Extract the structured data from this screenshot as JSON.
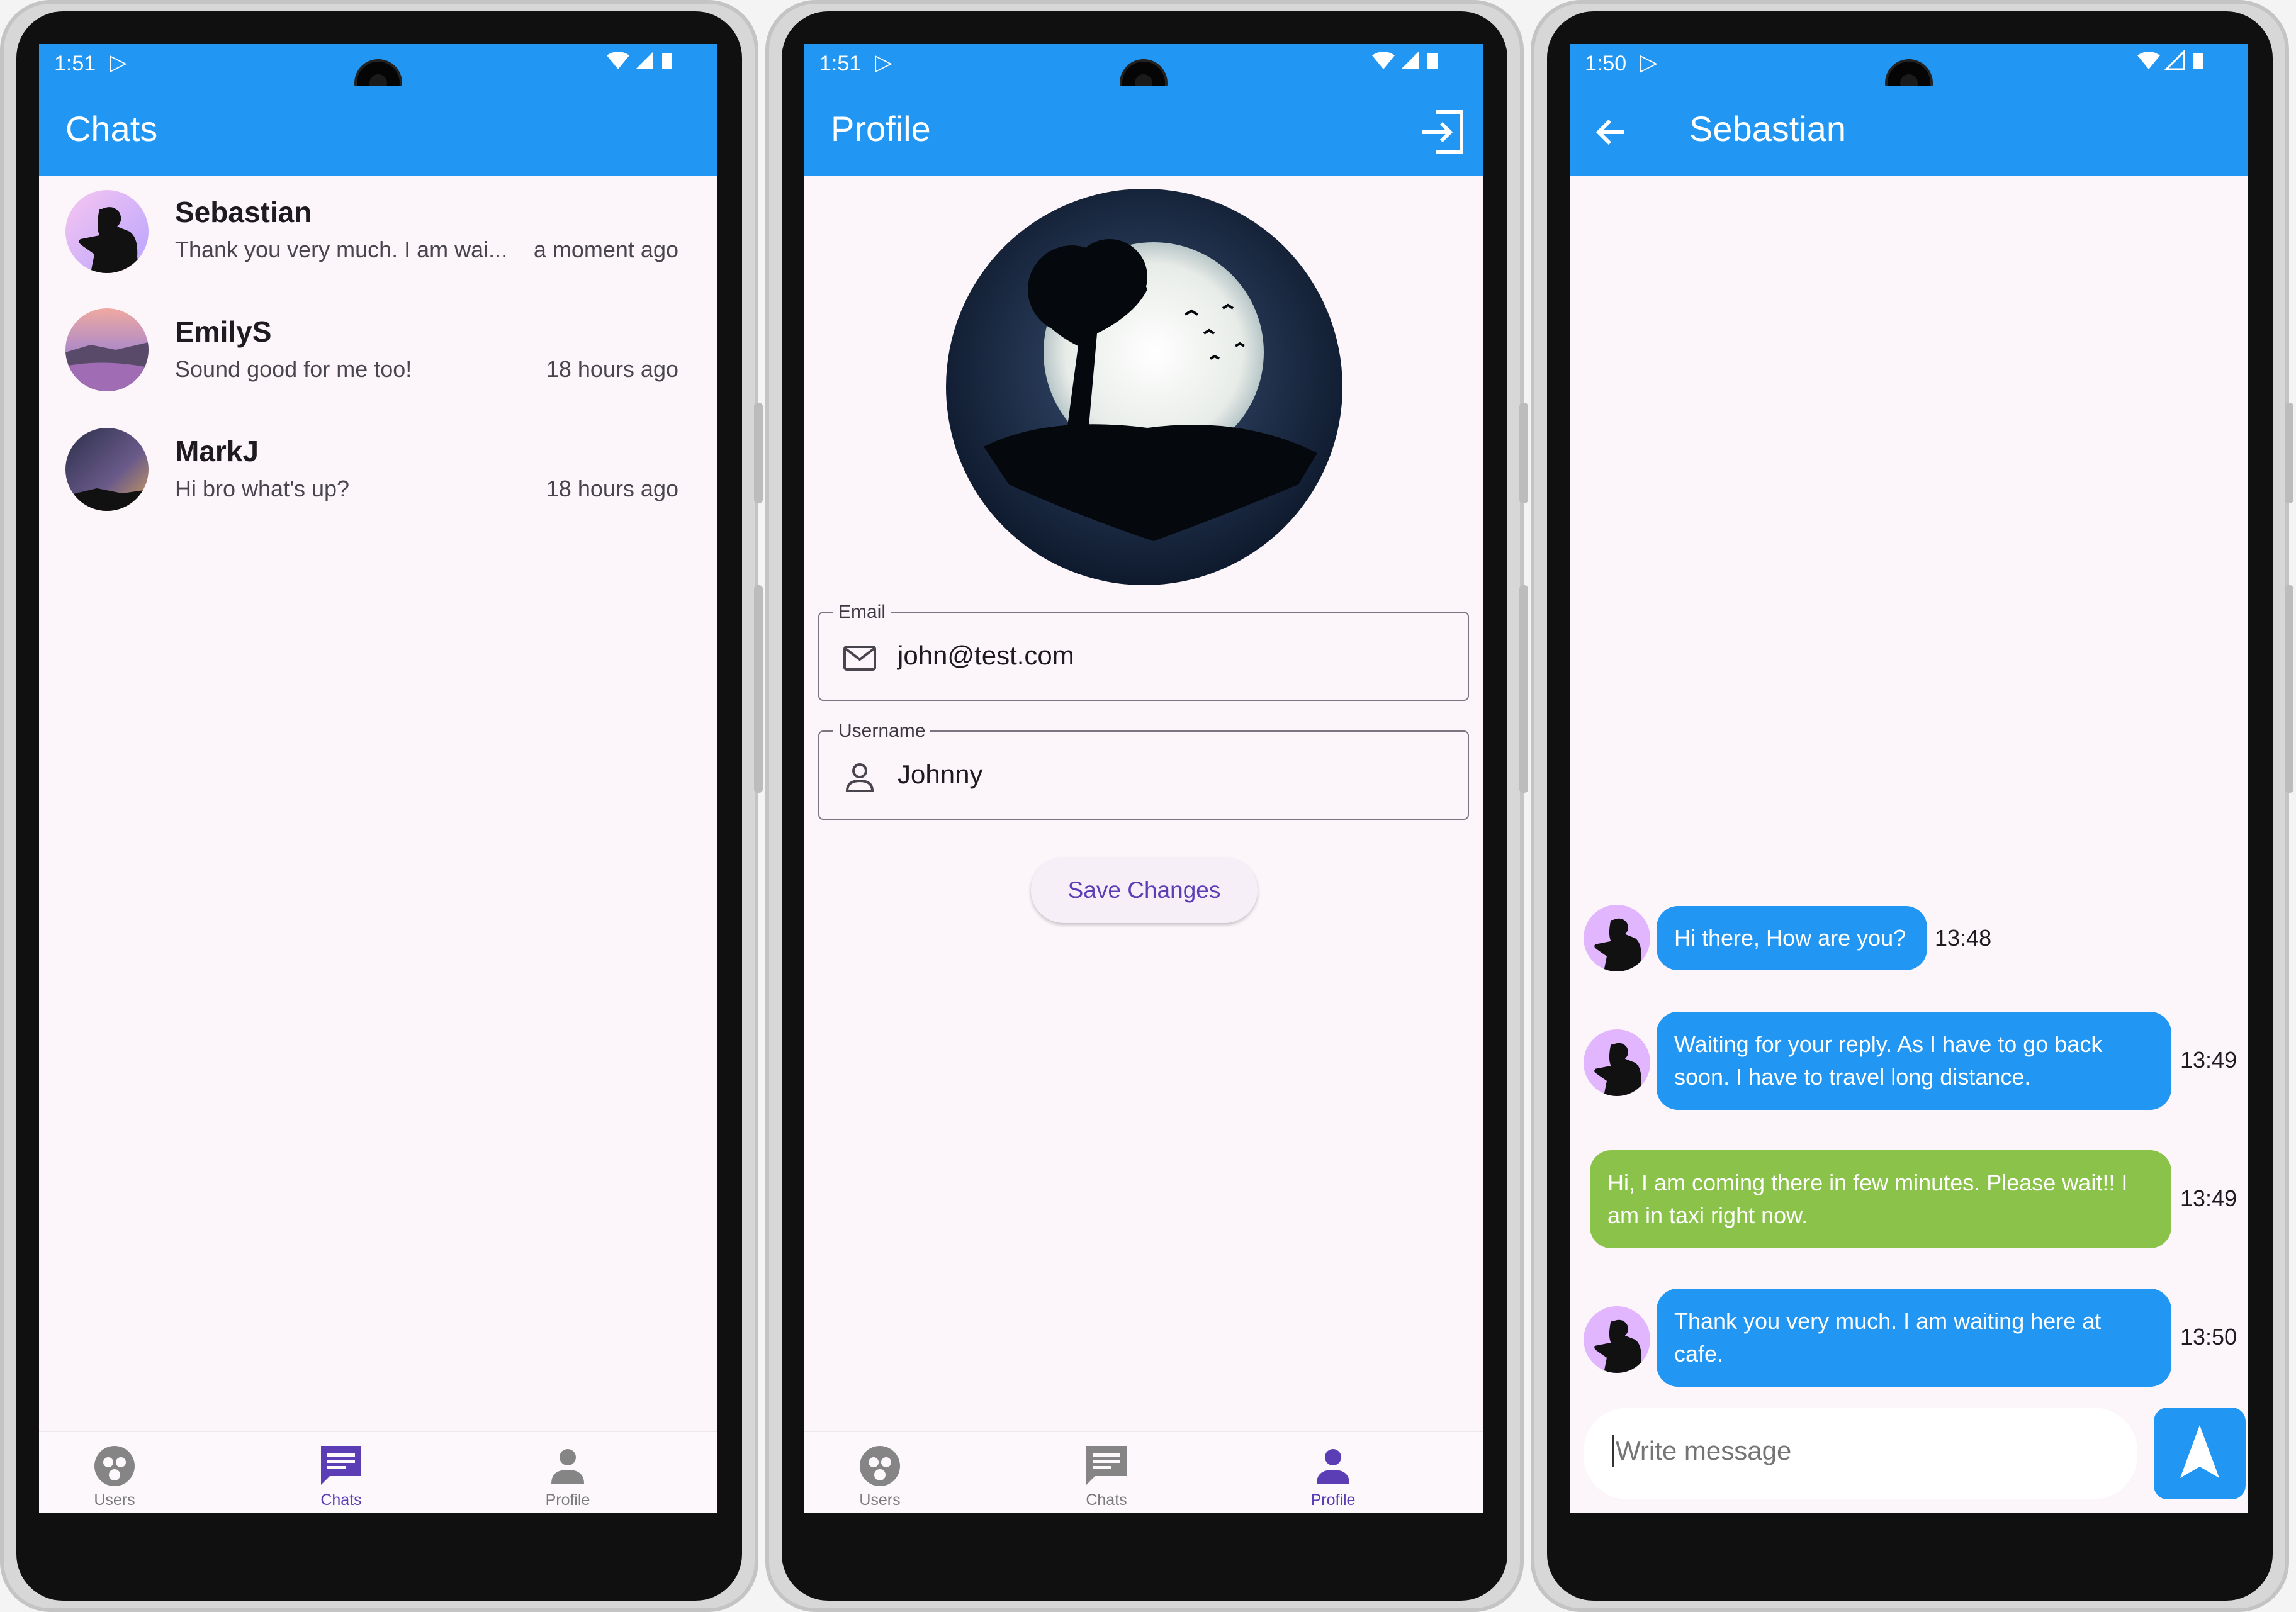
{
  "status": {
    "time_1": "1:51",
    "time_2": "1:51",
    "time_3": "1:50",
    "play_glyph": "▷",
    "icons": "▼◢▮"
  },
  "chats_screen": {
    "title": "Chats",
    "chats": [
      {
        "name": "Sebastian",
        "preview": "Thank you very much. I am wai...",
        "time": "a moment ago"
      },
      {
        "name": "EmilyS",
        "preview": "Sound good for me too!",
        "time": "18 hours ago"
      },
      {
        "name": "MarkJ",
        "preview": "Hi bro what's up?",
        "time": "18 hours ago"
      }
    ]
  },
  "profile_screen": {
    "title": "Profile",
    "email_label": "Email",
    "email_value": "john@test.com",
    "username_label": "Username",
    "username_value": "Johnny",
    "save_label": "Save Changes"
  },
  "conversation_screen": {
    "title": "Sebastian",
    "messages": [
      {
        "text": "Hi there, How are you?",
        "time": "13:48",
        "direction": "in"
      },
      {
        "text": "Waiting for your reply. As I have to go back soon. I have to travel long distance.",
        "time": "13:49",
        "direction": "in"
      },
      {
        "text": "Hi, I am coming there in few minutes. Please wait!! I am in taxi right now.",
        "time": "13:49",
        "direction": "out"
      },
      {
        "text": "Thank you very much. I am waiting here at cafe.",
        "time": "13:50",
        "direction": "in"
      }
    ],
    "composer_placeholder": "Write message"
  },
  "bottom_nav": {
    "users": "Users",
    "chats": "Chats",
    "profile": "Profile"
  },
  "colors": {
    "primary": "#2196f3",
    "sent_bubble": "#8bc34a",
    "nav_active": "#5b3db5",
    "background": "#fcf6fb"
  },
  "icons": [
    "play-store-icon",
    "wifi-icon",
    "signal-icon",
    "battery-icon",
    "logout-icon",
    "back-arrow-icon",
    "mail-icon",
    "person-icon",
    "users-icon",
    "chats-icon",
    "profile-icon",
    "send-icon"
  ]
}
